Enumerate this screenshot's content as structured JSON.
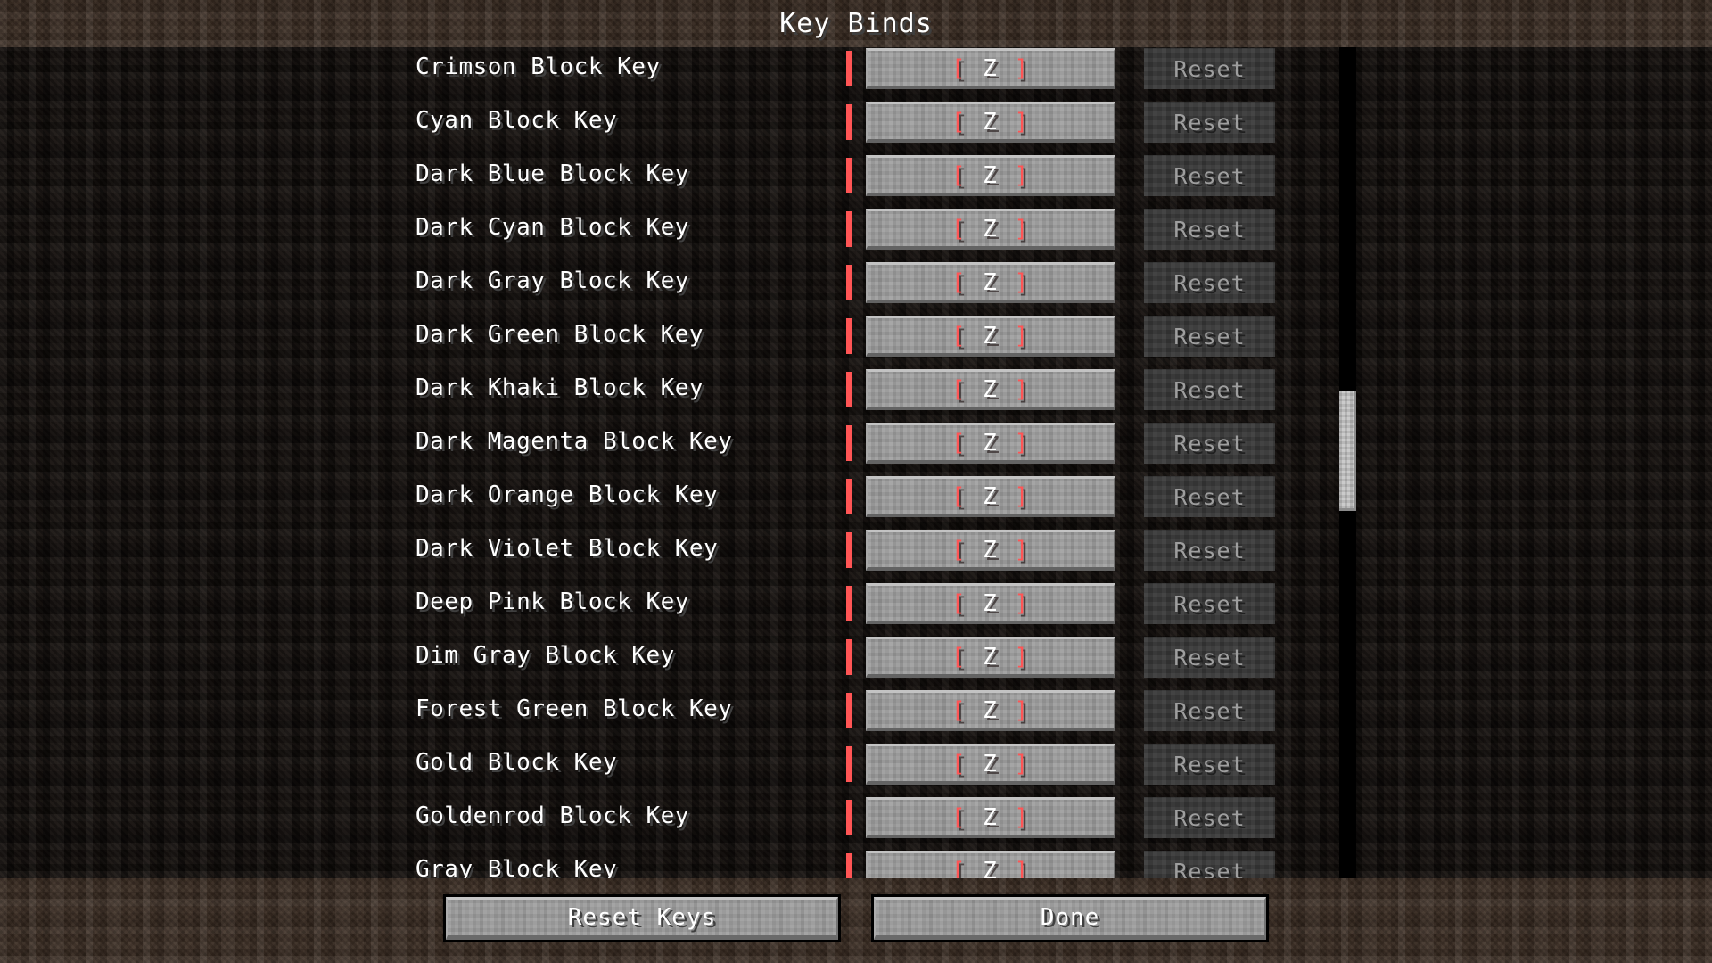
{
  "screen": {
    "title": "Key Binds",
    "type": "minecraft-options-controls-keybinds"
  },
  "colors": {
    "conflict_indicator": "#FF5555",
    "key_bracket": "#FF5555",
    "key_text": "#FFFFFF",
    "label_text": "#FFFFFF",
    "reset_disabled_text": "#9E9E9E",
    "button_face": "#9C9C9C",
    "reset_button_face": "#3D3D3D",
    "scrollbar_thumb": "#C6C6C6",
    "scrollbar_track": "#000000",
    "header_dirt": "#3A2C22",
    "list_background": "#16110E"
  },
  "list": {
    "reset_label": "Reset",
    "rows": [
      {
        "label": "Crimson Block Key",
        "key": "Z",
        "key_display": "[ Z ]",
        "conflict": true,
        "reset_enabled": false,
        "clipped": "top"
      },
      {
        "label": "Cyan Block Key",
        "key": "Z",
        "key_display": "[ Z ]",
        "conflict": true,
        "reset_enabled": false
      },
      {
        "label": "Dark Blue Block Key",
        "key": "Z",
        "key_display": "[ Z ]",
        "conflict": true,
        "reset_enabled": false
      },
      {
        "label": "Dark Cyan Block Key",
        "key": "Z",
        "key_display": "[ Z ]",
        "conflict": true,
        "reset_enabled": false
      },
      {
        "label": "Dark Gray Block Key",
        "key": "Z",
        "key_display": "[ Z ]",
        "conflict": true,
        "reset_enabled": false
      },
      {
        "label": "Dark Green Block Key",
        "key": "Z",
        "key_display": "[ Z ]",
        "conflict": true,
        "reset_enabled": false
      },
      {
        "label": "Dark Khaki Block Key",
        "key": "Z",
        "key_display": "[ Z ]",
        "conflict": true,
        "reset_enabled": false
      },
      {
        "label": "Dark Magenta Block Key",
        "key": "Z",
        "key_display": "[ Z ]",
        "conflict": true,
        "reset_enabled": false
      },
      {
        "label": "Dark Orange Block Key",
        "key": "Z",
        "key_display": "[ Z ]",
        "conflict": true,
        "reset_enabled": false
      },
      {
        "label": "Dark Violet Block Key",
        "key": "Z",
        "key_display": "[ Z ]",
        "conflict": true,
        "reset_enabled": false
      },
      {
        "label": "Deep Pink Block Key",
        "key": "Z",
        "key_display": "[ Z ]",
        "conflict": true,
        "reset_enabled": false
      },
      {
        "label": "Dim Gray Block Key",
        "key": "Z",
        "key_display": "[ Z ]",
        "conflict": true,
        "reset_enabled": false
      },
      {
        "label": "Forest Green Block Key",
        "key": "Z",
        "key_display": "[ Z ]",
        "conflict": true,
        "reset_enabled": false
      },
      {
        "label": "Gold Block Key",
        "key": "Z",
        "key_display": "[ Z ]",
        "conflict": true,
        "reset_enabled": false
      },
      {
        "label": "Goldenrod Block Key",
        "key": "Z",
        "key_display": "[ Z ]",
        "conflict": true,
        "reset_enabled": false
      },
      {
        "label": "Gray Block Key",
        "key": "Z",
        "key_display": "[ Z ]",
        "conflict": true,
        "reset_enabled": false,
        "clipped": "bottom"
      }
    ]
  },
  "scrollbar": {
    "orientation": "vertical",
    "thumb_position_percent": 41
  },
  "footer": {
    "reset_keys_label": "Reset Keys",
    "done_label": "Done"
  }
}
